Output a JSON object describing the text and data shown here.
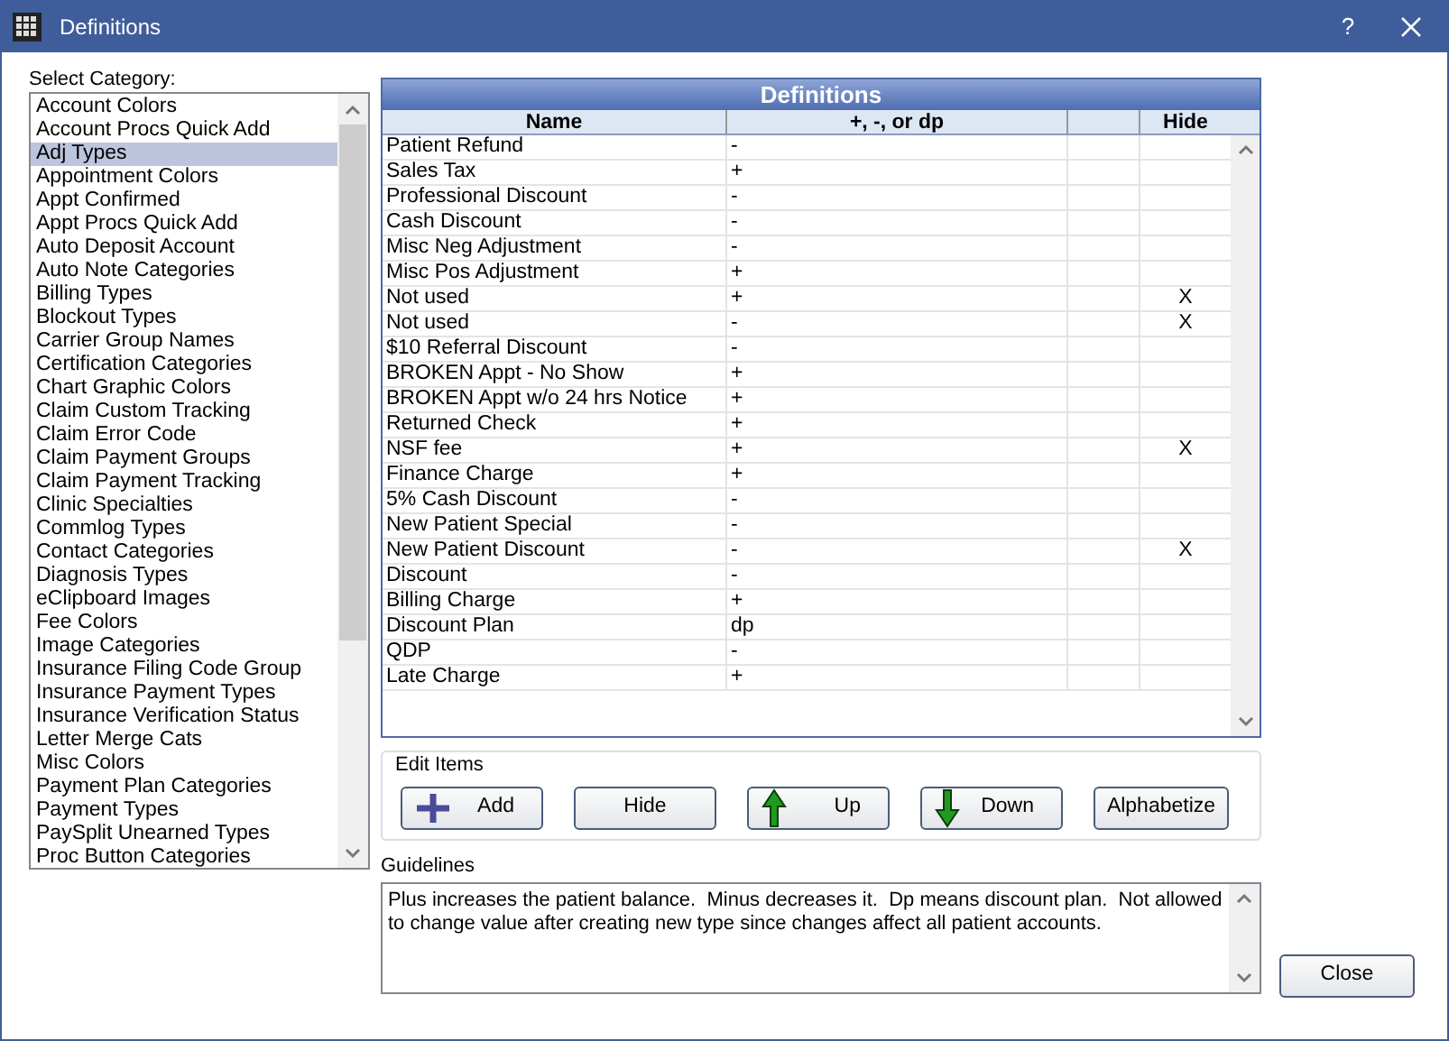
{
  "window": {
    "title": "Definitions",
    "help": "?"
  },
  "category_label": "Select Category:",
  "categories": [
    {
      "label": "Account Colors",
      "selected": false
    },
    {
      "label": "Account Procs Quick Add",
      "selected": false
    },
    {
      "label": "Adj Types",
      "selected": true
    },
    {
      "label": "Appointment Colors",
      "selected": false
    },
    {
      "label": "Appt Confirmed",
      "selected": false
    },
    {
      "label": "Appt Procs Quick Add",
      "selected": false
    },
    {
      "label": "Auto Deposit Account",
      "selected": false
    },
    {
      "label": "Auto Note Categories",
      "selected": false
    },
    {
      "label": "Billing Types",
      "selected": false
    },
    {
      "label": "Blockout Types",
      "selected": false
    },
    {
      "label": "Carrier Group Names",
      "selected": false
    },
    {
      "label": "Certification Categories",
      "selected": false
    },
    {
      "label": "Chart Graphic Colors",
      "selected": false
    },
    {
      "label": "Claim Custom Tracking",
      "selected": false
    },
    {
      "label": "Claim Error Code",
      "selected": false
    },
    {
      "label": "Claim Payment Groups",
      "selected": false
    },
    {
      "label": "Claim Payment Tracking",
      "selected": false
    },
    {
      "label": "Clinic Specialties",
      "selected": false
    },
    {
      "label": "Commlog Types",
      "selected": false
    },
    {
      "label": "Contact Categories",
      "selected": false
    },
    {
      "label": "Diagnosis Types",
      "selected": false
    },
    {
      "label": "eClipboard Images",
      "selected": false
    },
    {
      "label": "Fee Colors",
      "selected": false
    },
    {
      "label": "Image Categories",
      "selected": false
    },
    {
      "label": "Insurance Filing Code Group",
      "selected": false
    },
    {
      "label": "Insurance Payment Types",
      "selected": false
    },
    {
      "label": "Insurance Verification Status",
      "selected": false
    },
    {
      "label": "Letter Merge Cats",
      "selected": false
    },
    {
      "label": "Misc Colors",
      "selected": false
    },
    {
      "label": "Payment Plan Categories",
      "selected": false
    },
    {
      "label": "Payment Types",
      "selected": false
    },
    {
      "label": "PaySplit Unearned Types",
      "selected": false
    },
    {
      "label": "Proc Button Categories",
      "selected": false
    }
  ],
  "table": {
    "title": "Definitions",
    "columns": [
      "Name",
      "+, -, or dp",
      "Hide"
    ],
    "rows": [
      {
        "name": "Patient Refund",
        "value": "-"
      },
      {
        "name": "Sales Tax",
        "value": "+"
      },
      {
        "name": "Professional Discount",
        "value": "-"
      },
      {
        "name": "Cash Discount",
        "value": "-"
      },
      {
        "name": "Misc Neg Adjustment",
        "value": "-"
      },
      {
        "name": "Misc Pos Adjustment",
        "value": "+"
      },
      {
        "name": "Not used",
        "value": "+",
        "hide": "X"
      },
      {
        "name": "Not used",
        "value": "-",
        "hide": "X"
      },
      {
        "name": "$10 Referral Discount",
        "value": "-"
      },
      {
        "name": "BROKEN Appt - No Show",
        "value": "+"
      },
      {
        "name": "BROKEN Appt w/o 24 hrs Notice",
        "value": "+"
      },
      {
        "name": "Returned Check",
        "value": "+"
      },
      {
        "name": "NSF fee",
        "value": "+",
        "hide": "X"
      },
      {
        "name": "Finance Charge",
        "value": "+"
      },
      {
        "name": "5% Cash Discount",
        "value": "-"
      },
      {
        "name": "New Patient Special",
        "value": "-"
      },
      {
        "name": "New Patient Discount",
        "value": "-",
        "hide": "X"
      },
      {
        "name": "Discount",
        "value": "-"
      },
      {
        "name": "Billing Charge",
        "value": "+"
      },
      {
        "name": "Discount Plan",
        "value": "dp"
      },
      {
        "name": "QDP",
        "value": "-"
      },
      {
        "name": "Late Charge",
        "value": "+"
      }
    ]
  },
  "edit_items": {
    "title": "Edit Items",
    "buttons": [
      {
        "label": "Add",
        "kind": "add"
      },
      {
        "label": "Hide",
        "kind": "plain"
      },
      {
        "label": "Up",
        "kind": "up"
      },
      {
        "label": "Down",
        "kind": "down"
      },
      {
        "label": "Alphabetize",
        "kind": "plain"
      }
    ]
  },
  "guidelines": {
    "label": "Guidelines",
    "text": "Plus increases the patient balance.  Minus decreases it.  Dp means discount plan.  Not allowed to change value after creating new type since changes affect all patient accounts."
  },
  "close_button": "Close"
}
